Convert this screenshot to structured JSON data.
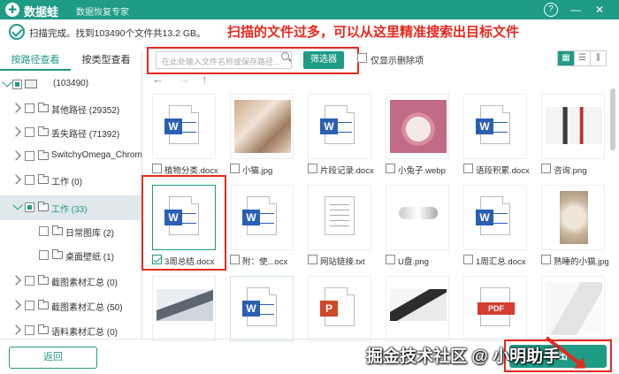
{
  "app": {
    "name": "数据蛙",
    "subtitle": "数据恢复专家",
    "help_label": "?",
    "minimize_label": "—",
    "close_label": "✕"
  },
  "status": {
    "text": "扫描完成。找到103490个文件共13.2 GB。"
  },
  "annotation": {
    "text": "扫描的文件过多，可以从这里精准搜索出目标文件"
  },
  "tabs": [
    {
      "label": "按路径查看",
      "active": true
    },
    {
      "label": "按类型查看",
      "active": false
    }
  ],
  "tree": [
    {
      "label": "(103490)",
      "expanded": true
    },
    {
      "label": "其他路径 (29352)"
    },
    {
      "label": "丢失路径 (71392)"
    },
    {
      "label": "SwitchyOmega_Chromiur"
    },
    {
      "label": "工作 (0)"
    },
    {
      "label": "工作 (33)",
      "selected": true
    },
    {
      "label": "日常图库 (2)"
    },
    {
      "label": "桌面壁纸 (1)"
    },
    {
      "label": "截图素材汇总 (0)"
    },
    {
      "label": "截图素材汇总 (50)"
    },
    {
      "label": "语料素材汇总 (0)"
    }
  ],
  "search": {
    "placeholder": "在此处输入文件名称或保存路径...",
    "filter_label": "筛选器",
    "only_deleted_label": "仅显示删除项"
  },
  "nav": {
    "back": "←",
    "forward": "→",
    "up": "↑"
  },
  "files": [
    {
      "name": "植物分类.docx",
      "type": "word"
    },
    {
      "name": "小猫.jpg",
      "type": "photo-cat"
    },
    {
      "name": "片段记录.docx",
      "type": "word"
    },
    {
      "name": "小兔子.webp",
      "type": "photo-rabbit"
    },
    {
      "name": "语段积累.docx",
      "type": "word"
    },
    {
      "name": "咨询.png",
      "type": "photo-office"
    },
    {
      "name": "3周总结.docx",
      "type": "word",
      "checked": true
    },
    {
      "name": "附：使...ocx",
      "type": "word"
    },
    {
      "name": "网站链接.txt",
      "type": "txt"
    },
    {
      "name": "U盘.png",
      "type": "photo-usb"
    },
    {
      "name": "1周汇总.docx",
      "type": "word"
    },
    {
      "name": "熟睡的小猫.jpg",
      "type": "photo-sleepcat"
    },
    {
      "name": "",
      "type": "photo-laptop"
    },
    {
      "name": "",
      "type": "word"
    },
    {
      "name": "",
      "type": "ppt"
    },
    {
      "name": "",
      "type": "photo-desk"
    },
    {
      "name": "",
      "type": "pdf"
    },
    {
      "name": "",
      "type": "photo-paper"
    }
  ],
  "buttons": {
    "back_label": "返回",
    "export_label": "导出"
  },
  "watermark": "掘金技术社区 @ 小明助手",
  "colors": {
    "accent": "#1f9b86",
    "annotation_red": "#e8281e",
    "word_blue": "#2b5fb4",
    "ppt_orange": "#d24726",
    "pdf_red": "#d63b2f"
  }
}
